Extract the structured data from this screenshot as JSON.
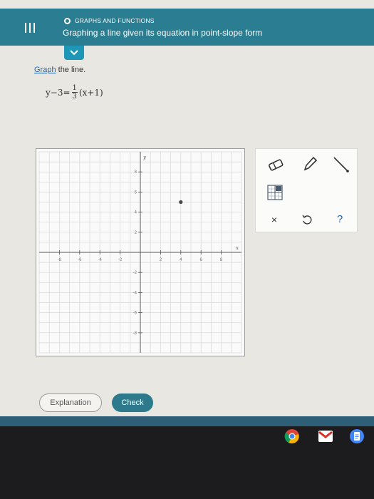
{
  "header": {
    "topic": "GRAPHS AND FUNCTIONS",
    "title": "Graphing a line given its equation in point-slope form"
  },
  "instruction": {
    "link_text": "Graph",
    "rest": " the line."
  },
  "equation": {
    "lhs": "y−3=",
    "numerator": "1",
    "denominator": "3",
    "rhs": "(x+1)"
  },
  "graph": {
    "x_axis_label": "x",
    "y_axis_label": "y",
    "x_range": [
      -10,
      10
    ],
    "y_range": [
      -10,
      10
    ],
    "tick_labels_x": [
      "-8",
      "-6",
      "-4",
      "-2",
      "2",
      "4",
      "6",
      "8"
    ],
    "tick_labels_y": [
      "8",
      "6",
      "4",
      "2",
      "-2",
      "-4",
      "-6",
      "-8"
    ],
    "plotted_point": [
      4,
      5
    ]
  },
  "tools": {
    "eraser": "eraser-icon",
    "pencil": "pencil-icon",
    "line": "line-tool-icon",
    "grid": "grid-toggle-icon",
    "clear": "×",
    "undo": "undo-icon",
    "help": "?"
  },
  "buttons": {
    "explanation": "Explanation",
    "check": "Check"
  },
  "colors": {
    "header": "#2b7d91",
    "check_button": "#2c7a8c",
    "link": "#2563a8"
  }
}
